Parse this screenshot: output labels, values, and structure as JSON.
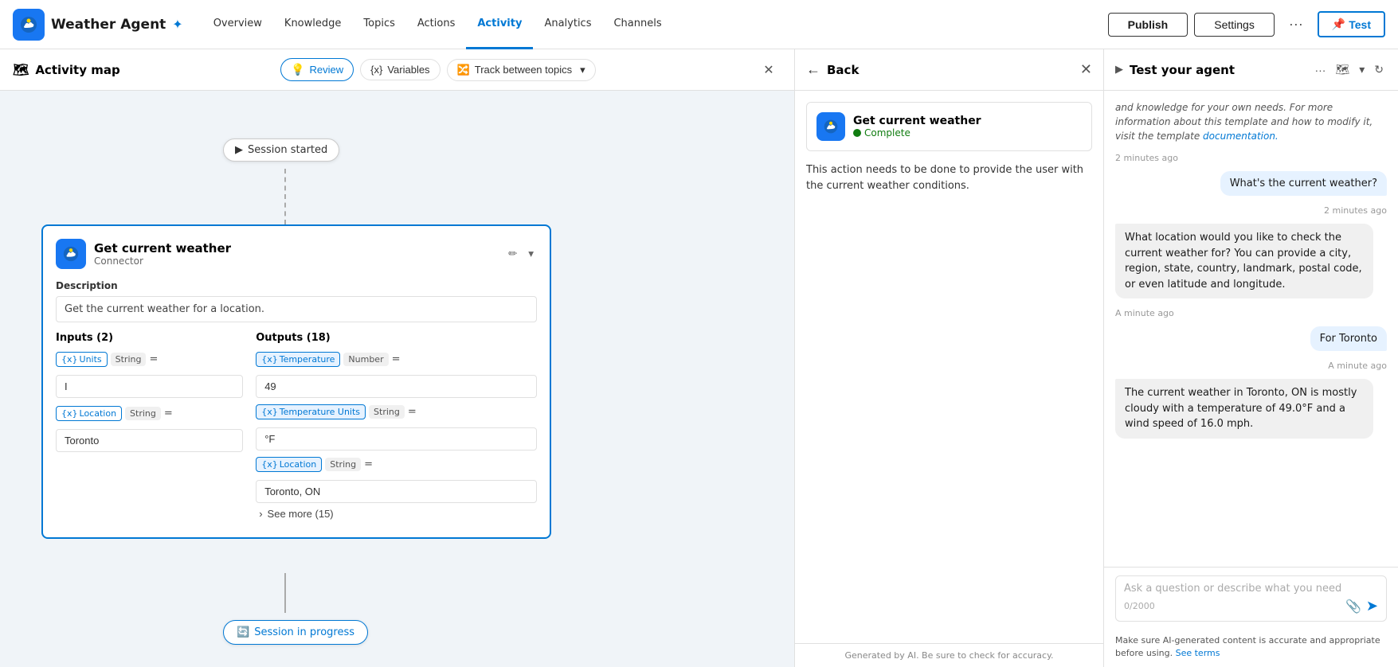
{
  "nav": {
    "app_title": "Weather Agent",
    "items": [
      {
        "label": "Overview",
        "active": false
      },
      {
        "label": "Knowledge",
        "active": false
      },
      {
        "label": "Topics",
        "active": false
      },
      {
        "label": "Actions",
        "active": false
      },
      {
        "label": "Activity",
        "active": true
      },
      {
        "label": "Analytics",
        "active": false
      },
      {
        "label": "Channels",
        "active": false
      }
    ],
    "publish_label": "Publish",
    "settings_label": "Settings",
    "test_label": "Test"
  },
  "toolbar": {
    "title": "Activity map",
    "review_label": "Review",
    "variables_label": "Variables",
    "track_label": "Track between topics"
  },
  "canvas": {
    "session_started_label": "Session started",
    "session_progress_label": "Session in progress"
  },
  "card": {
    "title": "Get current weather",
    "subtitle": "Connector",
    "description_label": "Description",
    "description": "Get the current weather for a location.",
    "inputs_label": "Inputs (2)",
    "outputs_label": "Outputs (18)",
    "input1_name": "Units",
    "input1_type": "String",
    "input1_value": "I",
    "input2_name": "Location",
    "input2_type": "String",
    "input2_value": "Toronto",
    "output1_name": "Temperature",
    "output1_type": "Number",
    "output1_value": "49",
    "output2_name": "Temperature Units",
    "output2_type": "String",
    "output2_value": "°F",
    "output3_name": "Location",
    "output3_type": "String",
    "output3_value": "Toronto, ON",
    "see_more_label": "See more (15)"
  },
  "detail": {
    "back_label": "Back",
    "title": "Back",
    "card_title": "Get current weather",
    "status": "Complete",
    "description": "This action needs to be done to provide the user with the current weather conditions.",
    "footer": "Generated by AI. Be sure to check for accuracy."
  },
  "test": {
    "title": "Test your agent",
    "intro_text": "and knowledge for your own needs. For more information about this template and how to modify it, visit the template",
    "intro_link": "documentation.",
    "timestamp1": "2 minutes ago",
    "msg1": "What's the current weather?",
    "timestamp2": "2 minutes ago",
    "msg2": "What location would you like to check the current weather for? You can provide a city, region, state, country, landmark, postal code, or even latitude and longitude.",
    "timestamp3": "A minute ago",
    "msg3": "For Toronto",
    "timestamp4": "A minute ago",
    "msg4": "The current weather in Toronto, ON is mostly cloudy with a temperature of 49.0°F and a wind speed of 16.0 mph.",
    "input_placeholder": "Ask a question or describe what you need",
    "char_count": "0/2000",
    "footer_text": "Make sure AI-generated content is accurate and appropriate before using.",
    "footer_link": "See terms"
  }
}
